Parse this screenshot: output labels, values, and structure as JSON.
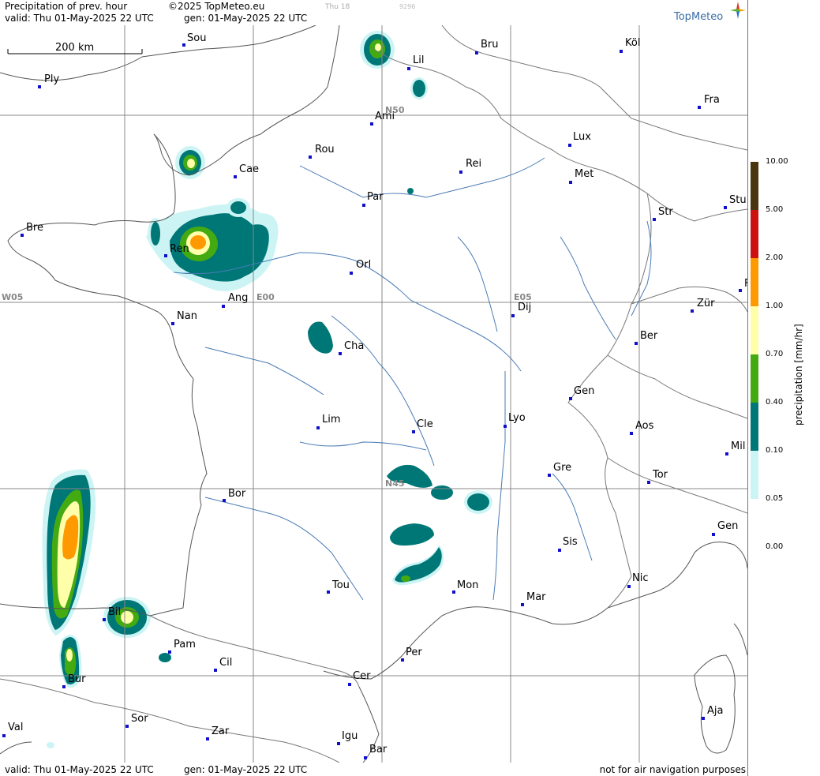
{
  "header": {
    "title": "Precipitation of prev. hour",
    "copyright": "©2025 TopMeteo.eu",
    "valid": "valid:  Thu  01-May-2025  22 UTC",
    "gen": "gen: 01-May-2025 22 UTC",
    "day_hint": "Thu 18",
    "num_hint": "9296"
  },
  "logo": {
    "text": "TopMeteo",
    "icon": "compass-star-icon"
  },
  "scale": {
    "label": "200 km"
  },
  "grid_labels": {
    "n50": "N50",
    "n45": "N45",
    "w05": "W05",
    "e00": "E00",
    "e05": "E05"
  },
  "cities": [
    {
      "name": "Sou"
    },
    {
      "name": "Ply"
    },
    {
      "name": "Lil"
    },
    {
      "name": "Bru"
    },
    {
      "name": "Köl"
    },
    {
      "name": "Ami"
    },
    {
      "name": "Fra"
    },
    {
      "name": "Lux"
    },
    {
      "name": "Rou"
    },
    {
      "name": "Cae"
    },
    {
      "name": "Rei"
    },
    {
      "name": "Met"
    },
    {
      "name": "Par"
    },
    {
      "name": "Bre"
    },
    {
      "name": "Str"
    },
    {
      "name": "Stu"
    },
    {
      "name": "Ren"
    },
    {
      "name": "Orl"
    },
    {
      "name": "F"
    },
    {
      "name": "Ang"
    },
    {
      "name": "Dij"
    },
    {
      "name": "Zür"
    },
    {
      "name": "Nan"
    },
    {
      "name": "Cha"
    },
    {
      "name": "Ber"
    },
    {
      "name": "Gen"
    },
    {
      "name": "Lim"
    },
    {
      "name": "Cle"
    },
    {
      "name": "Lyo"
    },
    {
      "name": "Aos"
    },
    {
      "name": "Mil"
    },
    {
      "name": "Gre"
    },
    {
      "name": "Bor"
    },
    {
      "name": "Tor"
    },
    {
      "name": "Gen"
    },
    {
      "name": "Sis"
    },
    {
      "name": "Tou"
    },
    {
      "name": "Mon"
    },
    {
      "name": "Mar"
    },
    {
      "name": "Nic"
    },
    {
      "name": "Bil"
    },
    {
      "name": "Pam"
    },
    {
      "name": "Cil"
    },
    {
      "name": "Per"
    },
    {
      "name": "Bur"
    },
    {
      "name": "Cer"
    },
    {
      "name": "Sor"
    },
    {
      "name": "Aja"
    },
    {
      "name": "Val"
    },
    {
      "name": "Zar"
    },
    {
      "name": "Igu"
    },
    {
      "name": "Bar"
    }
  ],
  "legend": {
    "title": "precipitation [mm/hr]",
    "levels": [
      "10.00",
      "5.00",
      "2.00",
      "1.00",
      "0.70",
      "0.40",
      "0.10",
      "0.05",
      "0.00"
    ],
    "colors": [
      "#4b3510",
      "#cc1111",
      "#ff9900",
      "#ffffaa",
      "#44aa11",
      "#007777",
      "#ccf4f4"
    ]
  },
  "footer": {
    "valid": "valid:  Thu  01-May-2025  22 UTC",
    "gen": "gen: 01-May-2025 22 UTC",
    "note": "not for air navigation purposes"
  }
}
